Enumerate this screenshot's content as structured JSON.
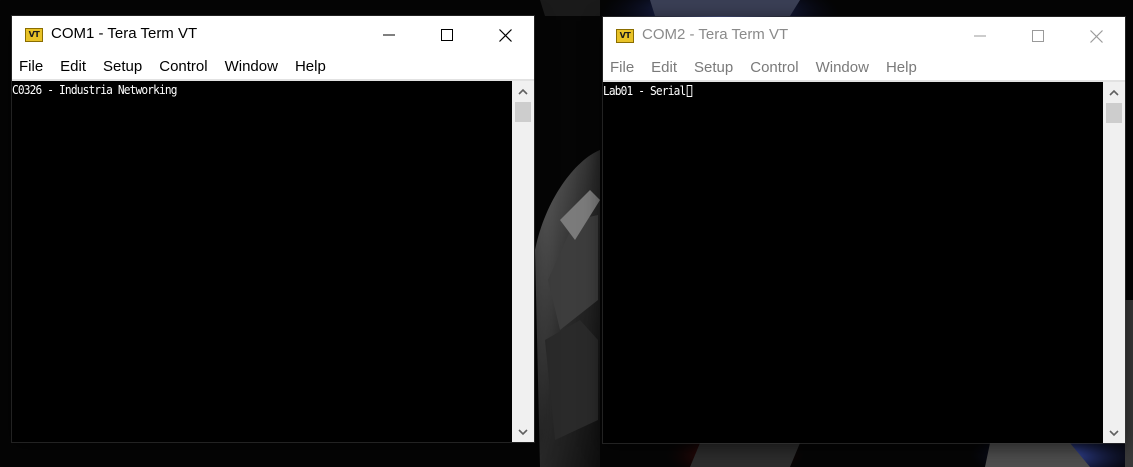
{
  "windows": [
    {
      "title": "COM1 - Tera Term VT",
      "state": "active",
      "app_icon": {
        "name": "tera-term-vt-icon",
        "text": "VT"
      },
      "controls": [
        "minimize-icon",
        "maximize-icon",
        "close-icon"
      ],
      "menu": [
        "File",
        "Edit",
        "Setup",
        "Control",
        "Window",
        "Help"
      ],
      "terminal": {
        "line": "C0326 - Industria Networking",
        "cursor": false
      },
      "scrollbar": [
        "scroll-up-arrow-icon",
        "scroll-down-arrow-icon"
      ]
    },
    {
      "title": "COM2 - Tera Term VT",
      "state": "inactive",
      "app_icon": {
        "name": "tera-term-vt-icon",
        "text": "VT"
      },
      "controls": [
        "minimize-icon",
        "maximize-icon",
        "close-icon"
      ],
      "menu": [
        "File",
        "Edit",
        "Setup",
        "Control",
        "Window",
        "Help"
      ],
      "terminal": {
        "line": "Lab01 - Serial",
        "cursor": true
      },
      "scrollbar": [
        "scroll-up-arrow-icon",
        "scroll-down-arrow-icon"
      ]
    }
  ],
  "colors": {
    "terminal_bg": "#000000",
    "terminal_fg": "#ffffff",
    "inactive_text": "#8a8a8a"
  }
}
